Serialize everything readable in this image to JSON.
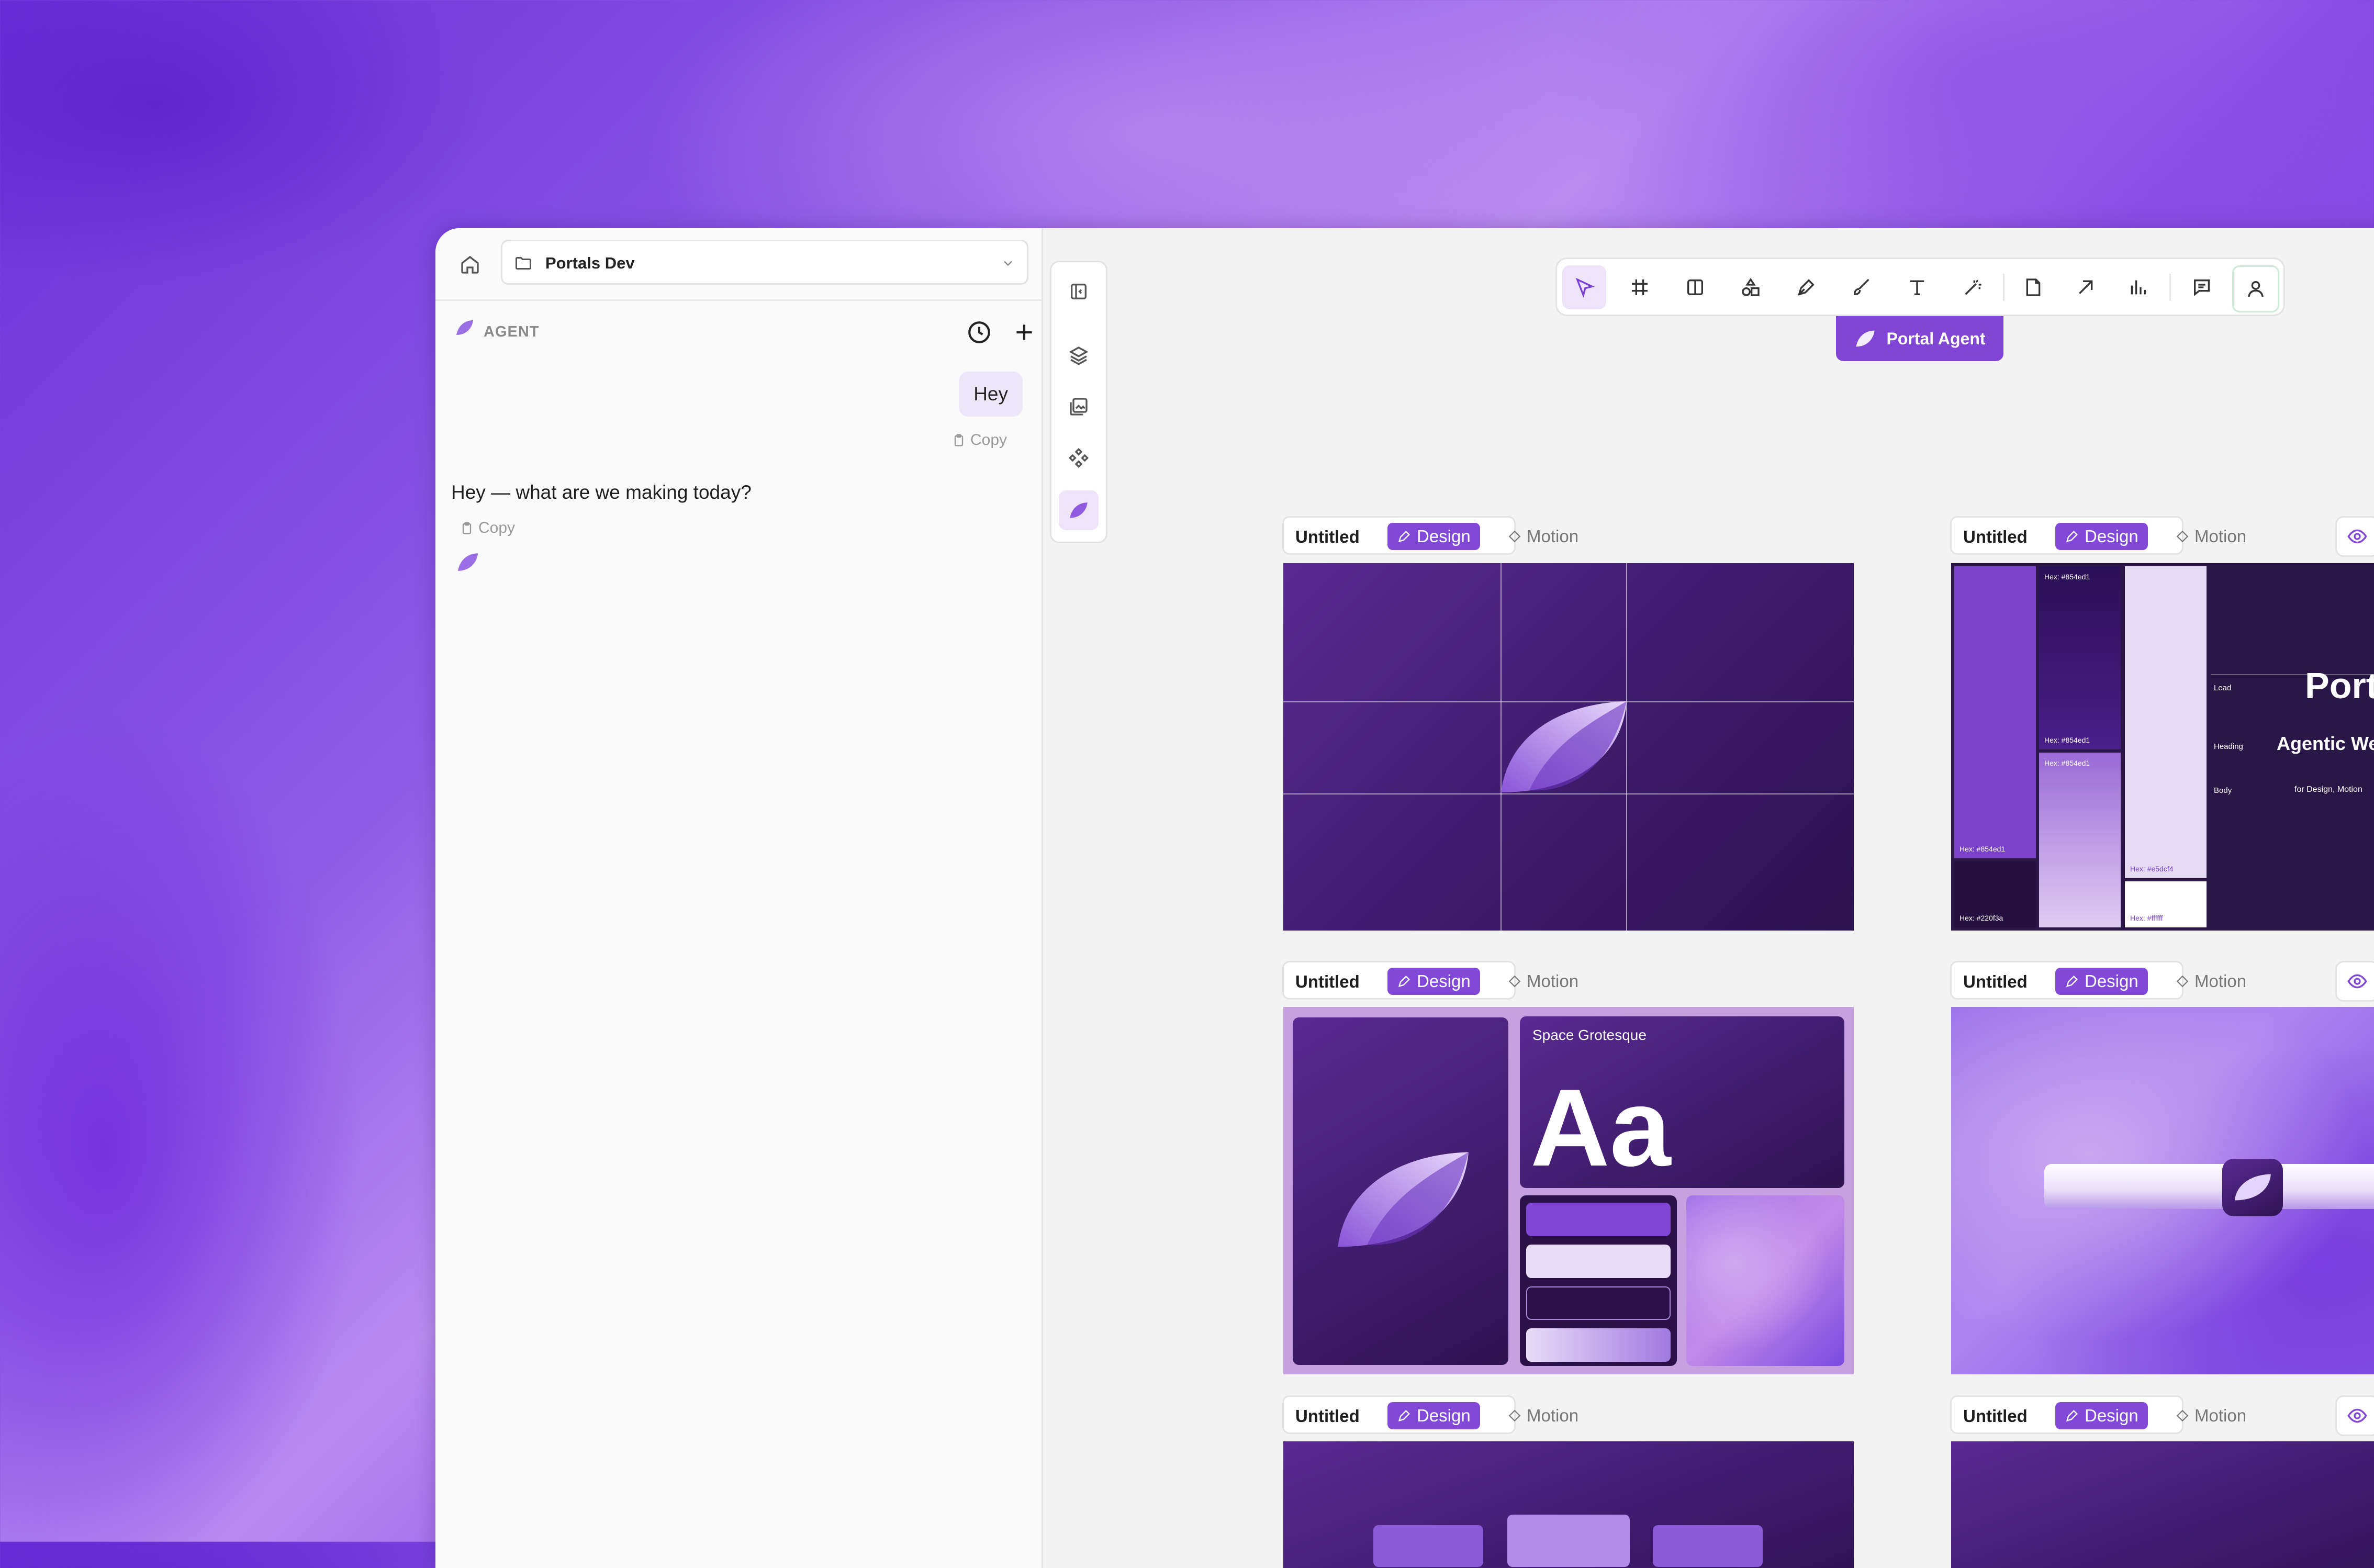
{
  "project": {
    "name": "Portals Dev"
  },
  "agent": {
    "label": "AGENT"
  },
  "chat": {
    "user_message": "Hey",
    "copy_label": "Copy",
    "reply": "Hey — what are we making today?"
  },
  "portal_agent": {
    "label": "Portal Agent"
  },
  "frame_tabs": {
    "title": "Untitled",
    "design": "Design",
    "motion": "Motion"
  },
  "brand_frame": {
    "swatches": [
      "Hex: #854ed1",
      "Hex: #220f3a",
      "Hex: #854ed1",
      "Hex: #854ed1",
      "Hex: #854ed1",
      "Hex: #e5dcf4",
      "Hex: #ffffff"
    ],
    "type_labels": [
      "Lead",
      "Heading",
      "Body"
    ],
    "type_samples": [
      "Port",
      "Agentic We",
      "for Design, Motion"
    ]
  },
  "type_frame": {
    "font_name": "Space Grotesque",
    "sample": "Aa"
  },
  "colors": {
    "accent": "#8145d6",
    "accent_light": "#ede4fa"
  }
}
